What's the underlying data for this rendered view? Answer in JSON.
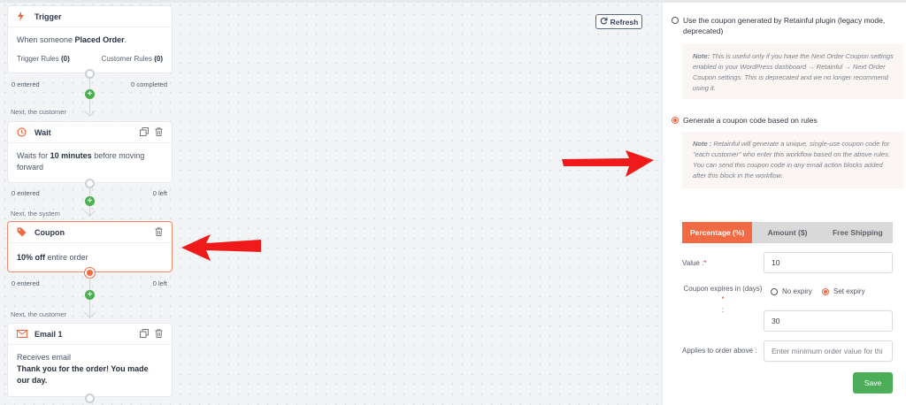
{
  "workflow": {
    "trigger": {
      "title": "Trigger",
      "desc_prefix": "When someone ",
      "desc_bold": "Placed Order",
      "desc_suffix": ".",
      "trigger_rules": "Trigger Rules",
      "trigger_rules_count": "(0)",
      "customer_rules": "Customer Rules",
      "customer_rules_count": "(0)",
      "entered": "0 entered",
      "completed": "0 completed",
      "next": "Next, the customer"
    },
    "wait": {
      "title": "Wait",
      "desc_prefix": "Waits for ",
      "desc_bold": "10 minutes",
      "desc_suffix": " before moving forward",
      "entered": "0 entered",
      "left": "0 left",
      "next": "Next, the system"
    },
    "coupon": {
      "title": "Coupon",
      "desc_bold": "10% off",
      "desc_suffix": " entire order",
      "entered": "0 entered",
      "left": "0 left",
      "next": "Next, the customer"
    },
    "email": {
      "title": "Email 1",
      "desc": "Receives email",
      "desc_bold": "Thank you for the order! You made our day."
    },
    "refresh_label": "Refresh"
  },
  "panel": {
    "option1_label": "Use the coupon generated by Retainful plugin (legacy mode, deprecated)",
    "note1_bold": "Note:",
    "note1_text": " This is useful only if you have the Next Order Coupon settings enabled in your WordPress dashboard → Retainful → Next Order Coupon settings. This is deprecated and we no longer recommend using it.",
    "option2_label": "Generate a coupon code based on rules",
    "note2_bold": "Note :",
    "note2_text": " Retainful will generate a unique, single-use coupon code for \"each customer\" who enter this workflow based on the above rules. You can send this coupon code in any email action blocks added after this block in the workflow.",
    "tabs": [
      "Percentage (%)",
      "Amount ($)",
      "Free Shipping"
    ],
    "value_label": "Value :",
    "value": "10",
    "expires_label": "Coupon expires in (days)",
    "expires_colon": ":",
    "no_expiry": "No expiry",
    "set_expiry": "Set expiry",
    "expiry_days": "30",
    "applies_label": "Applies to order above :",
    "applies_placeholder": "Enter minimum order value for thi",
    "save_label": "Save"
  },
  "colors": {
    "accent": "#f26a44",
    "success": "#4cae58",
    "arrow": "#f01a1a"
  }
}
